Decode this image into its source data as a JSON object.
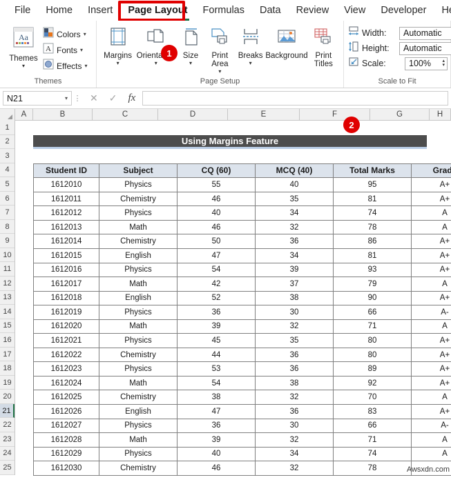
{
  "ribbon": {
    "tabs": [
      {
        "label": "File",
        "active": false
      },
      {
        "label": "Home",
        "active": false
      },
      {
        "label": "Insert",
        "active": false
      },
      {
        "label": "Page Layout",
        "active": true
      },
      {
        "label": "Formulas",
        "active": false
      },
      {
        "label": "Data",
        "active": false
      },
      {
        "label": "Review",
        "active": false
      },
      {
        "label": "View",
        "active": false
      },
      {
        "label": "Developer",
        "active": false
      },
      {
        "label": "Help",
        "active": false
      }
    ],
    "groups": {
      "themes": {
        "title": "Themes",
        "main_button": "Themes",
        "items": [
          {
            "label": "Colors",
            "icon": "colors-icon"
          },
          {
            "label": "Fonts",
            "icon": "fonts-icon"
          },
          {
            "label": "Effects",
            "icon": "effects-icon"
          }
        ]
      },
      "page_setup": {
        "title": "Page Setup",
        "buttons": [
          {
            "label": "Margins",
            "icon": "margins-icon",
            "has_caret": true
          },
          {
            "label": "Orientation",
            "icon": "orientation-icon",
            "has_caret": true
          },
          {
            "label": "Size",
            "icon": "size-icon",
            "has_caret": true
          },
          {
            "label": "Print Area",
            "icon": "print-area-icon",
            "has_caret": true
          },
          {
            "label": "Breaks",
            "icon": "breaks-icon",
            "has_caret": true
          },
          {
            "label": "Background",
            "icon": "background-icon",
            "has_caret": false
          },
          {
            "label": "Print Titles",
            "icon": "print-titles-icon",
            "has_caret": false
          }
        ],
        "launcher_label": "↘"
      },
      "scale_to_fit": {
        "title": "Scale to Fit",
        "rows": [
          {
            "label": "Width:",
            "value": "Automatic",
            "type": "dropdown",
            "icon": "width-icon"
          },
          {
            "label": "Height:",
            "value": "Automatic",
            "type": "dropdown",
            "icon": "height-icon"
          },
          {
            "label": "Scale:",
            "value": "100%",
            "type": "spinner",
            "icon": "scale-icon"
          }
        ],
        "launcher_label": "↘"
      }
    }
  },
  "annotations": [
    {
      "id": "1",
      "label": "1"
    },
    {
      "id": "2",
      "label": "2"
    }
  ],
  "formula_bar": {
    "name_box": "N21",
    "name_box_caret": "▾",
    "cancel_icon": "✕",
    "confirm_icon": "✓",
    "function_icon": "fx",
    "formula_value": ""
  },
  "grid": {
    "column_headers": [
      "A",
      "B",
      "C",
      "D",
      "E",
      "F",
      "G",
      "H"
    ],
    "row_headers": [
      "1",
      "2",
      "3",
      "4",
      "5",
      "6",
      "7",
      "8",
      "9",
      "10",
      "11",
      "12",
      "13",
      "14",
      "15",
      "16",
      "17",
      "18",
      "19",
      "20",
      "21",
      "22",
      "23",
      "24",
      "25"
    ],
    "selected_row": "21"
  },
  "sheet": {
    "title": "Using Margins Feature",
    "table": {
      "headers": [
        "Student ID",
        "Subject",
        "CQ  (60)",
        "MCQ  (40)",
        "Total Marks",
        "Grade"
      ],
      "rows": [
        [
          "1612010",
          "Physics",
          "55",
          "40",
          "95",
          "A+"
        ],
        [
          "1612011",
          "Chemistry",
          "46",
          "35",
          "81",
          "A+"
        ],
        [
          "1612012",
          "Physics",
          "40",
          "34",
          "74",
          "A"
        ],
        [
          "1612013",
          "Math",
          "46",
          "32",
          "78",
          "A"
        ],
        [
          "1612014",
          "Chemistry",
          "50",
          "36",
          "86",
          "A+"
        ],
        [
          "1612015",
          "English",
          "47",
          "34",
          "81",
          "A+"
        ],
        [
          "1612016",
          "Physics",
          "54",
          "39",
          "93",
          "A+"
        ],
        [
          "1612017",
          "Math",
          "42",
          "37",
          "79",
          "A"
        ],
        [
          "1612018",
          "English",
          "52",
          "38",
          "90",
          "A+"
        ],
        [
          "1612019",
          "Physics",
          "36",
          "30",
          "66",
          "A-"
        ],
        [
          "1612020",
          "Math",
          "39",
          "32",
          "71",
          "A"
        ],
        [
          "1612021",
          "Physics",
          "45",
          "35",
          "80",
          "A+"
        ],
        [
          "1612022",
          "Chemistry",
          "44",
          "36",
          "80",
          "A+"
        ],
        [
          "1612023",
          "Physics",
          "53",
          "36",
          "89",
          "A+"
        ],
        [
          "1612024",
          "Math",
          "54",
          "38",
          "92",
          "A+"
        ],
        [
          "1612025",
          "Chemistry",
          "38",
          "32",
          "70",
          "A"
        ],
        [
          "1612026",
          "English",
          "47",
          "36",
          "83",
          "A+"
        ],
        [
          "1612027",
          "Physics",
          "36",
          "30",
          "66",
          "A-"
        ],
        [
          "1612028",
          "Math",
          "39",
          "32",
          "71",
          "A"
        ],
        [
          "1612029",
          "Physics",
          "40",
          "34",
          "74",
          "A"
        ],
        [
          "1612030",
          "Chemistry",
          "46",
          "32",
          "78",
          ""
        ]
      ]
    }
  },
  "watermark": "Awsxdn.com",
  "colors": {
    "accent_green": "#1e7145",
    "annotation_red": "#e00000",
    "title_bg": "#4d4d4d",
    "table_header_bg": "#dce3ec"
  }
}
